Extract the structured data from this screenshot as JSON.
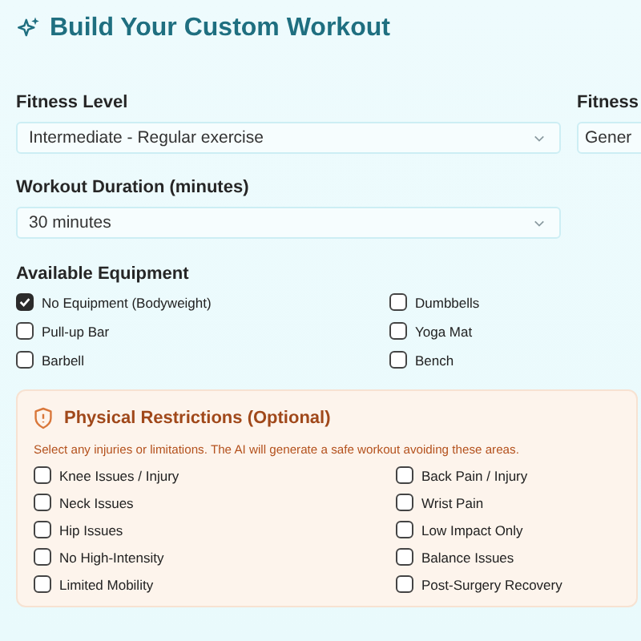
{
  "title": "Build Your Custom Workout",
  "fields": [
    {
      "label": "Fitness Level",
      "value": "Intermediate - Regular exercise"
    },
    {
      "label": "Fitness",
      "value": "Gener"
    }
  ],
  "duration": {
    "label": "Workout Duration (minutes)",
    "value": "30 minutes"
  },
  "equipment": {
    "label": "Available Equipment",
    "items": [
      {
        "label": "No Equipment (Bodyweight)",
        "checked": true
      },
      {
        "label": "Dumbbells",
        "checked": false
      },
      {
        "label": "Pull-up Bar",
        "checked": false
      },
      {
        "label": "Yoga Mat",
        "checked": false
      },
      {
        "label": "Barbell",
        "checked": false
      },
      {
        "label": "Bench",
        "checked": false
      }
    ]
  },
  "restrictions": {
    "title": "Physical Restrictions (Optional)",
    "description": "Select any injuries or limitations. The AI will generate a safe workout avoiding these areas.",
    "items": [
      {
        "label": "Knee Issues / Injury",
        "checked": false
      },
      {
        "label": "Back Pain / Injury",
        "checked": false
      },
      {
        "label": "Neck Issues",
        "checked": false
      },
      {
        "label": "Wrist Pain",
        "checked": false
      },
      {
        "label": "Hip Issues",
        "checked": false
      },
      {
        "label": "Low Impact Only",
        "checked": false
      },
      {
        "label": "No High-Intensity",
        "checked": false
      },
      {
        "label": "Balance Issues",
        "checked": false
      },
      {
        "label": "Limited Mobility",
        "checked": false
      },
      {
        "label": "Post-Surgery Recovery",
        "checked": false
      }
    ]
  }
}
